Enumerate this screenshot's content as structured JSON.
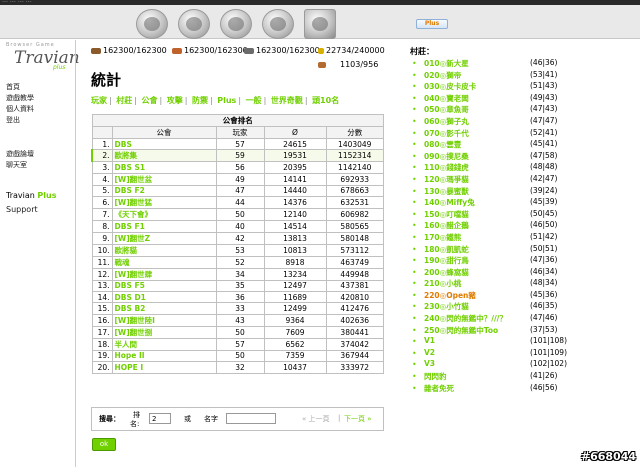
{
  "topbar": {
    "status": "…  …  …  …"
  },
  "header": {
    "plus_label": "Plus"
  },
  "logo": {
    "tagline": "Browser Game",
    "word": "Travian",
    "suffix": "plus"
  },
  "left_menu": {
    "group1": [
      "首頁",
      "遊戲教學",
      "個人資料",
      "登出"
    ],
    "group2": [
      "遊戲論壇",
      "聊天室"
    ],
    "travian": "Travian",
    "plus": "Plus",
    "support": "Support"
  },
  "resources": [
    {
      "name": "wood-icon",
      "color": "#8a5a2b",
      "value": "162300/162300"
    },
    {
      "name": "clay-icon",
      "color": "#c0622c",
      "value": "162300/162300"
    },
    {
      "name": "iron-icon",
      "color": "#6b6b6b",
      "value": "162300/162300"
    },
    {
      "name": "crop-icon",
      "color": "#d8b000",
      "value": "22734/240000"
    }
  ],
  "crop_consumption": "1103/956",
  "page_title": "統計",
  "tabs": [
    "玩家",
    "村莊",
    "公會",
    "攻擊",
    "防禦",
    "Plus",
    "一般",
    "世界奇觀",
    "頭10名"
  ],
  "table": {
    "caption": "公會排名",
    "headers": [
      "",
      "公會",
      "玩家",
      "Ø",
      "分數"
    ],
    "rows": [
      {
        "rank": "1.",
        "name": "DBS",
        "players": "57",
        "avg": "24615",
        "points": "1403049"
      },
      {
        "rank": "2.",
        "name": "歐將集",
        "players": "59",
        "avg": "19531",
        "points": "1152314"
      },
      {
        "rank": "3.",
        "name": "DBS S1",
        "players": "56",
        "avg": "20395",
        "points": "1142140"
      },
      {
        "rank": "4.",
        "name": "[W]翻世盆",
        "players": "49",
        "avg": "14141",
        "points": "692933"
      },
      {
        "rank": "5.",
        "name": "DBS F2",
        "players": "47",
        "avg": "14440",
        "points": "678663"
      },
      {
        "rank": "6.",
        "name": "[W]翻世猛",
        "players": "44",
        "avg": "14376",
        "points": "632531"
      },
      {
        "rank": "7.",
        "name": "《天下會》",
        "players": "50",
        "avg": "12140",
        "points": "606982"
      },
      {
        "rank": "8.",
        "name": "DBS F1",
        "players": "40",
        "avg": "14514",
        "points": "580565"
      },
      {
        "rank": "9.",
        "name": "[W]翻世Z",
        "players": "42",
        "avg": "13813",
        "points": "580148"
      },
      {
        "rank": "10.",
        "name": "歐將貓",
        "players": "53",
        "avg": "10813",
        "points": "573112"
      },
      {
        "rank": "11.",
        "name": "戰魂",
        "players": "52",
        "avg": "8918",
        "points": "463749"
      },
      {
        "rank": "12.",
        "name": "[W]翻世肆",
        "players": "34",
        "avg": "13234",
        "points": "449948"
      },
      {
        "rank": "13.",
        "name": "DBS F5",
        "players": "35",
        "avg": "12497",
        "points": "437381"
      },
      {
        "rank": "14.",
        "name": "DBS D1",
        "players": "36",
        "avg": "11689",
        "points": "420810"
      },
      {
        "rank": "15.",
        "name": "DBS B2",
        "players": "33",
        "avg": "12499",
        "points": "412476"
      },
      {
        "rank": "16.",
        "name": "[W]翻世陸I",
        "players": "43",
        "avg": "9364",
        "points": "402636"
      },
      {
        "rank": "17.",
        "name": "[W]翻世捌",
        "players": "50",
        "avg": "7609",
        "points": "380441"
      },
      {
        "rank": "18.",
        "name": "半人間",
        "players": "57",
        "avg": "6562",
        "points": "374042"
      },
      {
        "rank": "19.",
        "name": "Hope II",
        "players": "50",
        "avg": "7359",
        "points": "367944"
      },
      {
        "rank": "20.",
        "name": "HOPE I",
        "players": "32",
        "avg": "10437",
        "points": "333972"
      }
    ]
  },
  "search": {
    "search_label": "搜尋：",
    "rank_label": "排",
    "rank_label2": "名:",
    "rank_value": "2",
    "or_label": "或",
    "name_label": "名字",
    "name_value": "",
    "prev": "« 上一頁",
    "next": "下一頁 »"
  },
  "ok_label": "ok",
  "villages_title": "村莊：",
  "villages": [
    {
      "name": "010◎新大星",
      "coords": "(46|36)"
    },
    {
      "name": "020◎獅帝",
      "coords": "(53|41)"
    },
    {
      "name": "030◎皮卡皮卡",
      "coords": "(51|43)"
    },
    {
      "name": "040◎寶老闆",
      "coords": "(49|43)"
    },
    {
      "name": "050◎章魚哥",
      "coords": "(47|43)"
    },
    {
      "name": "060◎獅子丸",
      "coords": "(47|47)"
    },
    {
      "name": "070◎影千代",
      "coords": "(52|41)"
    },
    {
      "name": "080◎雲豐",
      "coords": "(45|41)"
    },
    {
      "name": "090◎撲尼桑",
      "coords": "(47|58)"
    },
    {
      "name": "110◎錢錢虎",
      "coords": "(48|48)"
    },
    {
      "name": "120◎瑪爭貓",
      "coords": "(42|47)"
    },
    {
      "name": "130◎暴蜜獸",
      "coords": "(39|24)"
    },
    {
      "name": "140◎Miffy兔",
      "coords": "(45|39)"
    },
    {
      "name": "150◎叮噹貓",
      "coords": "(50|45)"
    },
    {
      "name": "160◎醋企鵝",
      "coords": "(46|50)"
    },
    {
      "name": "170◎鐵熊",
      "coords": "(51|42)"
    },
    {
      "name": "180◎凱凱蛇",
      "coords": "(50|51)"
    },
    {
      "name": "190◎甜行鳥",
      "coords": "(47|36)"
    },
    {
      "name": "200◎蜂窩貓",
      "coords": "(46|34)"
    },
    {
      "name": "210◎小桃",
      "coords": "(48|34)"
    },
    {
      "name": "220◎Open豬",
      "coords": "(45|36)",
      "active": true
    },
    {
      "name": "230◎小竹貓",
      "coords": "(46|35)"
    },
    {
      "name": "240◎閃的無鑑中？///？",
      "coords": "(47|46)"
    },
    {
      "name": "250◎閃的無鑑中Too",
      "coords": "(37|53)"
    },
    {
      "name": "V1",
      "coords": "(101|108)"
    },
    {
      "name": "V2",
      "coords": "(101|109)"
    },
    {
      "name": "V3",
      "coords": "(102|102)"
    },
    {
      "name": "閃閃豹",
      "coords": "(41|26)"
    },
    {
      "name": "雜者免死",
      "coords": "(46|56)"
    }
  ],
  "watermark": "#668044"
}
